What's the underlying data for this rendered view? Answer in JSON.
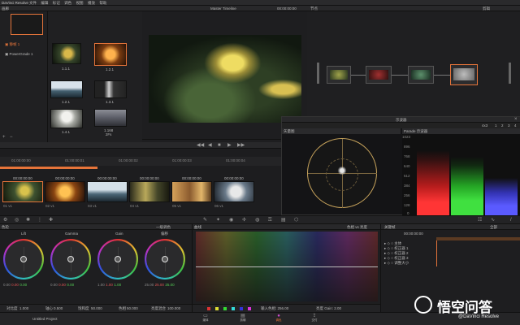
{
  "menubar": {
    "app": "DaVinci Resolve",
    "items": [
      "文件",
      "编辑",
      "标记",
      "调色",
      "视图",
      "播放",
      "帮助"
    ]
  },
  "gallery": {
    "title": "画廊",
    "albums": [
      "静帧 1",
      "PowerGrade 1"
    ],
    "stills": [
      {
        "label": "1.1.1",
        "selected": false
      },
      {
        "label": "1.2.1",
        "selected": true
      },
      {
        "label": "1.2.1",
        "selected": false
      },
      {
        "label": "1.3.1",
        "selected": false
      },
      {
        "label": "1.4.1",
        "selected": false
      },
      {
        "label": "1.168\n2Fs",
        "selected": false
      }
    ]
  },
  "viewer": {
    "title": "Master Timeline",
    "timecode": "00:00:00:00"
  },
  "nodes": {
    "title": "节点",
    "right_title": "剪辑"
  },
  "timeline": {
    "ruler": [
      "01:00:00:00",
      "01:00:00:01",
      "01:00:00:02",
      "01:00:00:03",
      "01:00:00:04"
    ],
    "clips": [
      {
        "tc": "00:00:00:00",
        "track": "01 v1",
        "selected": true
      },
      {
        "tc": "00:00:00:00",
        "track": "02 v1",
        "selected": false
      },
      {
        "tc": "00:00:00:00",
        "track": "03 v1",
        "selected": false
      },
      {
        "tc": "00:00:00:00",
        "track": "04 v1",
        "selected": false
      },
      {
        "tc": "00:00:00:00",
        "track": "05 v1",
        "selected": false
      },
      {
        "tc": "00:00:00:00",
        "track": "06 v1",
        "selected": false
      }
    ]
  },
  "scopes": {
    "title": "示波器",
    "left_label": "矢量图",
    "right_label": "Parade 示波器",
    "mode": "4x3",
    "counts": [
      "1",
      "2",
      "3",
      "4"
    ],
    "y_ticks": [
      "1023",
      "896",
      "768",
      "640",
      "512",
      "384",
      "256",
      "128",
      "0"
    ]
  },
  "color": {
    "title": "色轮",
    "mode_label": "一级调色",
    "wheels": [
      {
        "name": "Lift",
        "values": [
          "0.00",
          "0.00",
          "0.00",
          "0.00"
        ]
      },
      {
        "name": "Gamma",
        "values": [
          "0.00",
          "0.00",
          "0.00",
          "0.00"
        ]
      },
      {
        "name": "Gain",
        "values": [
          "1.00",
          "1.00",
          "1.00",
          "1.00"
        ]
      },
      {
        "name": "偏移",
        "values": [
          "25.00",
          "25.00",
          "25.00",
          "25.00"
        ]
      }
    ],
    "bottom": [
      {
        "label": "对比度",
        "value": "1.000"
      },
      {
        "label": "轴心",
        "value": "0.500"
      },
      {
        "label": "饱和度",
        "value": "50.000"
      },
      {
        "label": "色相",
        "value": "50.000"
      },
      {
        "label": "亮度混合",
        "value": "100.000"
      }
    ],
    "curves_title": "曲线",
    "curves_mode": "色相 vs 亮度",
    "curves_input": "输入色相: 256.00",
    "curves_gain": "亮度 Gain: 2.00"
  },
  "keyframes": {
    "title": "关键帧",
    "sub": "全部",
    "tc": "00:00:00:00",
    "rows": [
      "主体",
      "校正器 1",
      "校正器 2",
      "校正器 3",
      "调整大小"
    ]
  },
  "footer": {
    "project": "Untitled Project",
    "tabs": [
      "媒体",
      "剪辑",
      "调色",
      "交付"
    ]
  },
  "watermark": "悟空问答",
  "watermark_sub": "@DaVinci Resolve",
  "colors": {
    "accent": "#e5743a",
    "bg": "#1b1b1d"
  }
}
